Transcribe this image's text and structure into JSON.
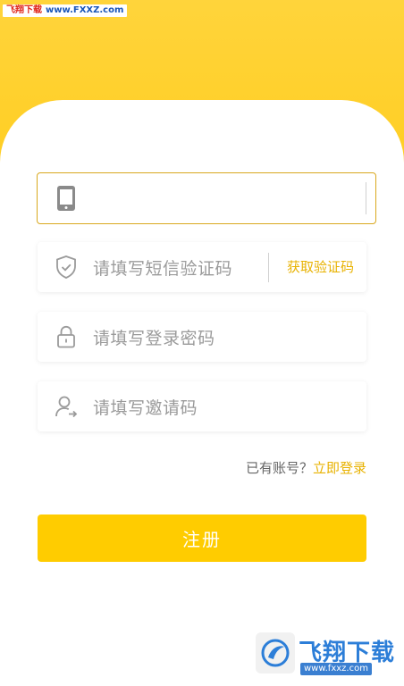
{
  "watermark_top": {
    "site_name": "飞翔下载",
    "url": "www.FXXZ.com"
  },
  "form": {
    "phone": {
      "value": "",
      "icon": "phone-icon"
    },
    "sms_code": {
      "placeholder": "请填写短信验证码",
      "icon": "shield-icon",
      "get_code_label": "获取验证码"
    },
    "password": {
      "placeholder": "请填写登录密码",
      "icon": "lock-icon"
    },
    "invite": {
      "placeholder": "请填写邀请码",
      "icon": "user-icon"
    }
  },
  "login_prompt": {
    "text": "已有账号？",
    "link": "立即登录"
  },
  "submit": {
    "label": "注册"
  },
  "brand_watermark": {
    "name": "飞翔下载",
    "url": "www.fxxz.com"
  },
  "colors": {
    "accent": "#FFCC00",
    "link": "#E8B200",
    "header": "#FFD43B"
  }
}
